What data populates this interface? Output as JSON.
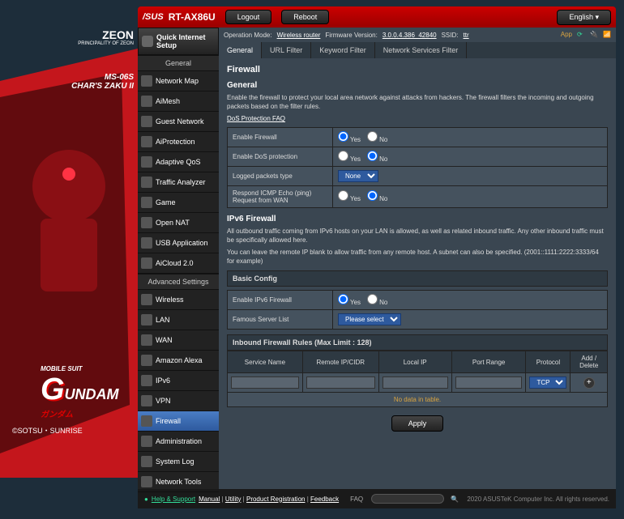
{
  "brand": {
    "zeon": "ZEON",
    "zeon_sub": "PRINCIPALITY\nOF ZEON",
    "model_code": "MS-06S",
    "model_name": "CHAR'S ZAKU II",
    "gundam_top": "MOBILE SUIT",
    "gundam_g": "G",
    "gundam_rest": "UNDAM",
    "gundam_jp": "ガンダム",
    "copyright": "©SOTSU・SUNRISE"
  },
  "top": {
    "asus": "/SUS",
    "model": "RT-AX86U",
    "logout": "Logout",
    "reboot": "Reboot",
    "lang": "English"
  },
  "info": {
    "op_label": "Operation Mode:",
    "op_mode": "Wireless router",
    "fw_label": "Firmware Version:",
    "fw": "3.0.0.4.386_42840",
    "ssid_label": "SSID:",
    "ssid": "ttr",
    "app": "App"
  },
  "sidebar": {
    "qis": "Quick Internet\nSetup",
    "general": "General",
    "general_items": [
      "Network Map",
      "AiMesh",
      "Guest Network",
      "AiProtection",
      "Adaptive QoS",
      "Traffic Analyzer",
      "Game",
      "Open NAT",
      "USB Application",
      "AiCloud 2.0"
    ],
    "advanced": "Advanced Settings",
    "advanced_items": [
      "Wireless",
      "LAN",
      "WAN",
      "Amazon Alexa",
      "IPv6",
      "VPN",
      "Firewall",
      "Administration",
      "System Log",
      "Network Tools"
    ],
    "active": "Firewall"
  },
  "tabs": [
    "General",
    "URL Filter",
    "Keyword Filter",
    "Network Services Filter"
  ],
  "active_tab": "General",
  "panel": {
    "title": "Firewall",
    "sub1": "General",
    "desc": "Enable the firewall to protect your local area network against attacks from hackers. The firewall filters the incoming and outgoing packets based on the filter rules.",
    "dos_faq": "DoS Protection FAQ",
    "rows": {
      "enable_fw": "Enable Firewall",
      "enable_dos": "Enable DoS protection",
      "logged": "Logged packets type",
      "icmp": "Respond ICMP Echo (ping) Request from WAN"
    },
    "yes": "Yes",
    "no": "No",
    "logged_opt": "None",
    "ipv6_title": "IPv6 Firewall",
    "ipv6_desc1": "All outbound traffic coming from IPv6 hosts on your LAN is allowed, as well as related inbound traffic. Any other inbound traffic must be specifically allowed here.",
    "ipv6_desc2": "You can leave the remote IP blank to allow traffic from any remote host. A subnet can also be specified. (2001::1111:2222:3333/64 for example)",
    "basic": "Basic Config",
    "enable_ipv6": "Enable IPv6 Firewall",
    "famous": "Famous Server List",
    "famous_opt": "Please select",
    "rules_hdr": "Inbound Firewall Rules (Max Limit : 128)",
    "cols": [
      "Service Name",
      "Remote IP/CIDR",
      "Local IP",
      "Port Range",
      "Protocol",
      "Add / Delete"
    ],
    "proto_opt": "TCP",
    "no_data": "No data in table.",
    "apply": "Apply"
  },
  "footer": {
    "help": "Help & Support",
    "links": [
      "Manual",
      "Utility",
      "Product Registration",
      "Feedback"
    ],
    "faq": "FAQ",
    "copy": "2020 ASUSTeK Computer Inc. All rights reserved."
  }
}
